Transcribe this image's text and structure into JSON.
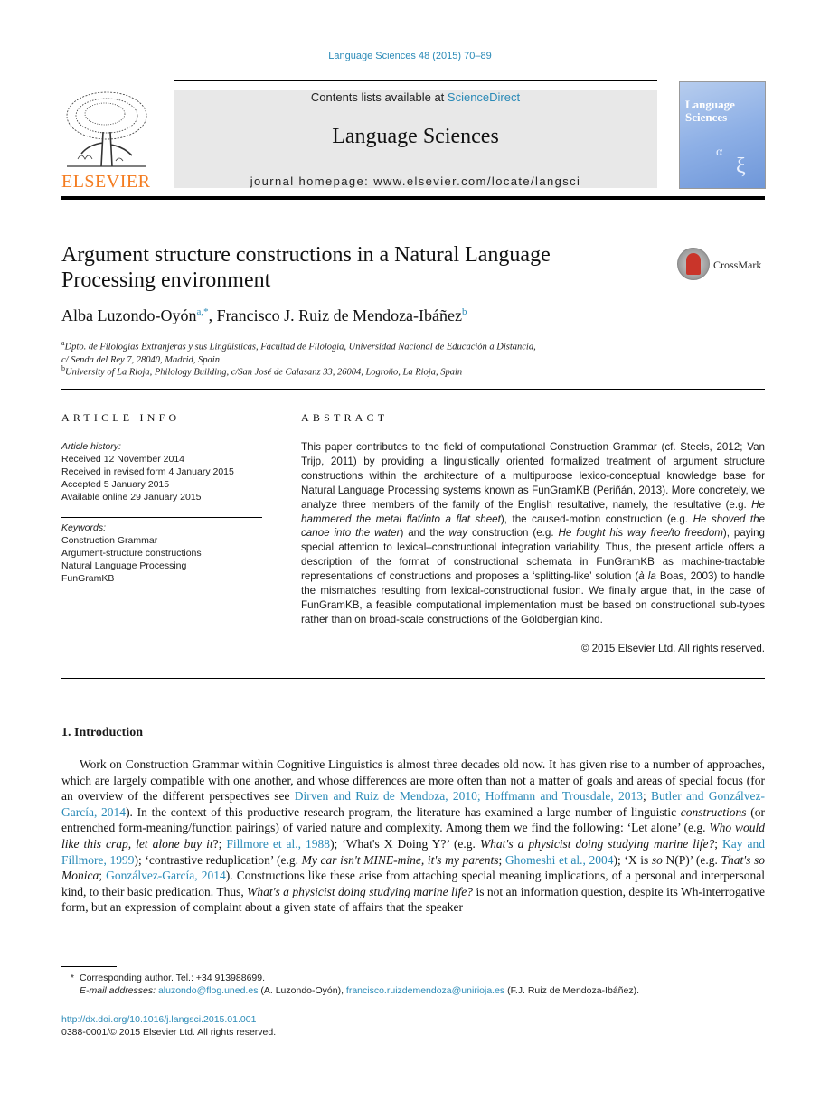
{
  "header": {
    "journal_ref": "Language Sciences 48 (2015) 70–89",
    "publisher": "ELSEVIER",
    "contents_prefix": "Contents lists available at ",
    "contents_link": "ScienceDirect",
    "journal_name": "Language Sciences",
    "homepage": "journal homepage: www.elsevier.com/locate/langsci",
    "cover_title_line1": "Language",
    "cover_title_line2": "Sciences",
    "crossmark_label": "CrossMark"
  },
  "article": {
    "title": "Argument structure constructions in a Natural Language Processing environment",
    "authors": [
      {
        "name": "Alba Luzondo-Oyón",
        "sup": "a,*"
      },
      {
        "name": "Francisco J. Ruiz de Mendoza-Ibáñez",
        "sup": "b"
      }
    ],
    "author_separator": ", ",
    "affiliations": [
      {
        "mark": "a",
        "line1": "Dpto. de Filologías Extranjeras y sus Lingüísticas, Facultad de Filología, Universidad Nacional de Educación a Distancia,",
        "line2": "c/ Senda del Rey 7, 28040, Madrid, Spain"
      },
      {
        "mark": "b",
        "line1": "University of La Rioja, Philology Building, c/San José de Calasanz 33, 26004, Logroño, La Rioja, Spain"
      }
    ]
  },
  "article_info": {
    "heading": "ARTICLE INFO",
    "history_label": "Article history:",
    "history": [
      "Received 12 November 2014",
      "Received in revised form 4 January 2015",
      "Accepted 5 January 2015",
      "Available online 29 January 2015"
    ],
    "keywords_label": "Keywords:",
    "keywords": [
      "Construction Grammar",
      "Argument-structure constructions",
      "Natural Language Processing",
      "FunGramKB"
    ]
  },
  "abstract": {
    "heading": "ABSTRACT",
    "segments": [
      {
        "t": "This paper contributes to the field of computational Construction Grammar (cf. Steels, 2012; Van Trijp, 2011) by providing a linguistically oriented formalized treatment of argument structure constructions within the architecture of a multipurpose lexico-conceptual knowledge base for Natural Language Processing systems known as FunGramKB (Periñán, 2013). More concretely, we analyze three members of the family of the English resultative, namely, the resultative (e.g. ",
        "i": false
      },
      {
        "t": "He hammered the metal flat/into a flat sheet",
        "i": true
      },
      {
        "t": "), the caused-motion construction (e.g. ",
        "i": false
      },
      {
        "t": "He shoved the canoe into the water",
        "i": true
      },
      {
        "t": ") and the ",
        "i": false
      },
      {
        "t": "way",
        "i": true
      },
      {
        "t": " construction (e.g. ",
        "i": false
      },
      {
        "t": "He fought his way free/to freedom",
        "i": true
      },
      {
        "t": "), paying special attention to lexical–constructional integration variability. Thus, the present article offers a description of the format of constructional schemata in FunGramKB as machine-tractable representations of constructions and proposes a ‘splitting-like’ solution (",
        "i": false
      },
      {
        "t": "à la",
        "i": true
      },
      {
        "t": " Boas, 2003) to handle the mismatches resulting from lexical-constructional fusion. We finally argue that, in the case of FunGramKB, a feasible computational implementation must be based on constructional sub-types rather than on broad-scale constructions of the Goldbergian kind.",
        "i": false
      }
    ],
    "copyright": "© 2015 Elsevier Ltd. All rights reserved."
  },
  "introduction": {
    "heading": "1.  Introduction",
    "segments": [
      {
        "t": "Work on Construction Grammar within Cognitive Linguistics is almost three decades old now. It has given rise to a number of approaches, which are largely compatible with one another, and whose differences are more often than not a matter of goals and areas of special focus (for an overview of the different perspectives see ",
        "k": "text"
      },
      {
        "t": "Dirven and Ruiz de Mendoza, 2010; Hoffmann and Trousdale, 2013",
        "k": "link"
      },
      {
        "t": "; ",
        "k": "text"
      },
      {
        "t": "Butler and Gonzálvez-García, 2014",
        "k": "link"
      },
      {
        "t": "). In the context of this productive research program, the literature has examined a large number of linguistic ",
        "k": "text"
      },
      {
        "t": "constructions",
        "k": "italic"
      },
      {
        "t": " (or entrenched form-meaning/function pairings) of varied nature and complexity. Among them we find the following: ‘Let alone’ (e.g. ",
        "k": "text"
      },
      {
        "t": "Who would like this crap, let alone buy it",
        "k": "italic"
      },
      {
        "t": "?; ",
        "k": "text"
      },
      {
        "t": "Fillmore et al., 1988",
        "k": "link"
      },
      {
        "t": "); ‘What's X Doing Y?’ (e.g. ",
        "k": "text"
      },
      {
        "t": "What's a physicist doing studying marine life?",
        "k": "italic"
      },
      {
        "t": "; ",
        "k": "text"
      },
      {
        "t": "Kay and Fillmore, 1999",
        "k": "link"
      },
      {
        "t": "); ‘contrastive reduplication’ (e.g. ",
        "k": "text"
      },
      {
        "t": "My car isn't MINE-mine, it's my parents",
        "k": "italic"
      },
      {
        "t": "; ",
        "k": "text"
      },
      {
        "t": "Ghomeshi et al., 2004",
        "k": "link"
      },
      {
        "t": "); ‘X is ",
        "k": "text"
      },
      {
        "t": "so",
        "k": "italic"
      },
      {
        "t": " N(P)’ (e.g. ",
        "k": "text"
      },
      {
        "t": "That's so Monica",
        "k": "italic"
      },
      {
        "t": "; ",
        "k": "text"
      },
      {
        "t": "Gonzálvez-García, 2014",
        "k": "link"
      },
      {
        "t": "). Constructions like these arise from attaching special meaning implications, of a personal and interpersonal kind, to their basic predication. Thus, ",
        "k": "text"
      },
      {
        "t": "What's a physicist doing studying marine life?",
        "k": "italic"
      },
      {
        "t": " is not an information question, despite its Wh-interrogative form, but an expression of complaint about a given state of affairs that the speaker",
        "k": "text"
      }
    ]
  },
  "footnotes": {
    "star": "*",
    "corresponding": "Corresponding author. Tel.: +34 913988699.",
    "email_label": "E-mail addresses:",
    "email1": "aluzondo@flog.uned.es",
    "email1_owner": " (A. Luzondo-Oyón), ",
    "email2": "francisco.ruizdemendoza@unirioja.es",
    "email2_owner": " (F.J. Ruiz de Mendoza-Ibáñez).",
    "doi": "http://dx.doi.org/10.1016/j.langsci.2015.01.001",
    "issn_copyright": "0388-0001/© 2015 Elsevier Ltd. All rights reserved."
  }
}
